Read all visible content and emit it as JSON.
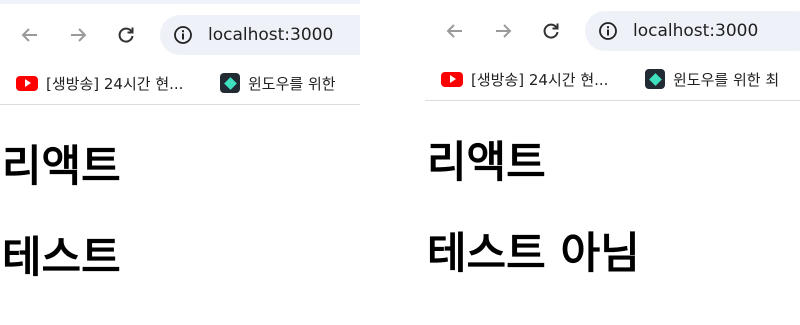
{
  "left": {
    "omnibox": {
      "url": "localhost:3000"
    },
    "bookmarks": [
      {
        "label": "[생방송] 24시간 현...",
        "icon": "youtube-icon"
      },
      {
        "label": "윈도우를 위한 ",
        "icon": "bookmark-app-icon"
      }
    ],
    "page": {
      "heading1": "리액트",
      "heading2": "테스트"
    }
  },
  "right": {
    "omnibox": {
      "url": "localhost:3000"
    },
    "bookmarks": [
      {
        "label": "[생방송] 24시간 현...",
        "icon": "youtube-icon"
      },
      {
        "label": "윈도우를 위한 최",
        "icon": "bookmark-app-icon"
      }
    ],
    "page": {
      "heading1": "리액트",
      "heading2": "테스트 아님"
    }
  },
  "colors": {
    "toolbar_bg": "#ffffff",
    "omnibox_bg": "#eef1f7",
    "youtube_red": "#ff0000",
    "text": "#000000"
  }
}
